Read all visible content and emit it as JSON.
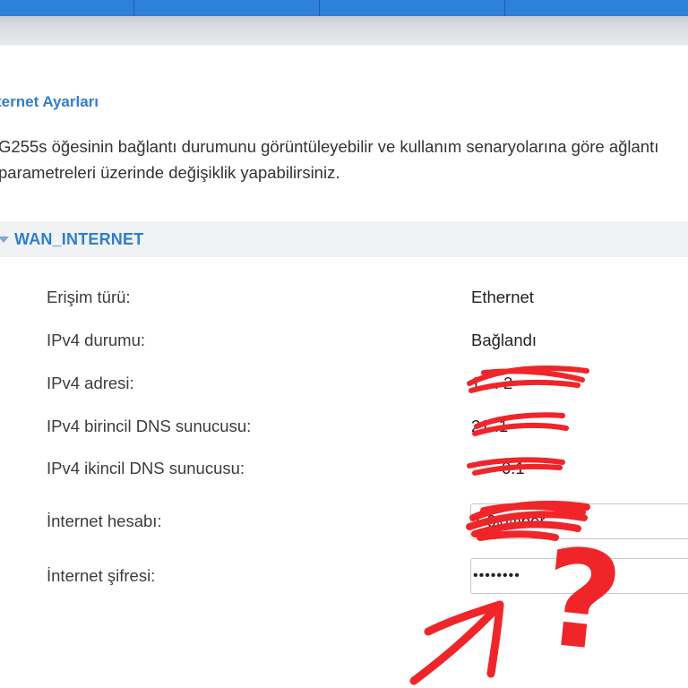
{
  "page": {
    "title": "ternet Ayarları",
    "description": "G255s öğesinin bağlantı durumunu görüntüleyebilir ve kullanım senaryolarına göre ağlantı parametreleri üzerinde değişiklik yapabilirsiniz."
  },
  "section": {
    "title": "WAN_INTERNET"
  },
  "rows": [
    {
      "label": "Erişim türü:",
      "value": "Ethernet"
    },
    {
      "label": "IPv4 durumu:",
      "value": "Bağlandı"
    },
    {
      "label": "IPv4 adresi:",
      "value": "1 . . 2"
    },
    {
      "label": "IPv4 birincil DNS sunucusu:",
      "value": "21 .1"
    },
    {
      "label": "IPv4 ikincil DNS sunucusu:",
      "value": "0.1"
    }
  ],
  "account": {
    "label": "İnternet hesabı:",
    "value": "1 0@fiber"
  },
  "password": {
    "label": "İnternet şifresi:",
    "value": "••••••••"
  },
  "annotation": {
    "question_mark": "?",
    "color": "#f0252a"
  },
  "colors": {
    "accent": "#2e7fd0",
    "nav": "#2f80d9",
    "section_bg": "#f1f2f3"
  }
}
